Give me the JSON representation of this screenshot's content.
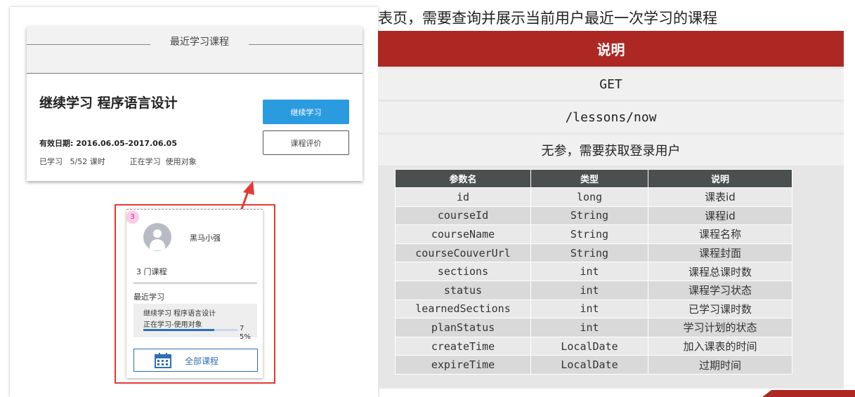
{
  "left": {
    "recent_card": {
      "title": "最近学习课程",
      "course_title": "继续学习  程序语言设计",
      "valid_date": "有效日期: 2016.06.05-2017.06.05",
      "progress": "已学习   5/52 课时          正在学习  使用对象",
      "continue_button": "继续学习",
      "review_button": "课程评价"
    },
    "user_card": {
      "badge": "3",
      "username": "黑马小强",
      "course_count": "3  门课程",
      "recent_label": "最近学习",
      "recent_course": "继续学习 程序语言设计",
      "recent_status": "正在学习-使用对象",
      "progress_percent": 75,
      "progress_text": "75%",
      "all_courses_button": "全部课程"
    }
  },
  "doc": {
    "heading": "表页，需要查询并展示当前用户最近一次学习的课程",
    "header": "说明",
    "method": "GET",
    "path": "/lessons/now",
    "params_note": "无参，需要获取登录用户",
    "table": {
      "headers": [
        "参数名",
        "类型",
        "说明"
      ],
      "rows": [
        [
          "id",
          "long",
          "课表id"
        ],
        [
          "courseId",
          "String",
          "课程id"
        ],
        [
          "courseName",
          "String",
          "课程名称"
        ],
        [
          "courseCouverUrl",
          "String",
          "课程封面"
        ],
        [
          "sections",
          "int",
          "课程总课时数"
        ],
        [
          "status",
          "int",
          "课程学习状态"
        ],
        [
          "learnedSections",
          "int",
          "已学习课时数"
        ],
        [
          "planStatus",
          "int",
          "学习计划的状态"
        ],
        [
          "createTime",
          "LocalDate",
          "加入课表的时间"
        ],
        [
          "expireTime",
          "LocalDate",
          "过期时间"
        ]
      ]
    }
  },
  "colors": {
    "header_red": "#ad2823",
    "primary_blue": "#2b9be0",
    "link_blue": "#2f6fb5",
    "highlight_frame": "#e53935",
    "table_header": "#4a4f4f"
  },
  "icons": [
    "user-avatar-icon",
    "calendar-icon",
    "arrow-icon"
  ]
}
